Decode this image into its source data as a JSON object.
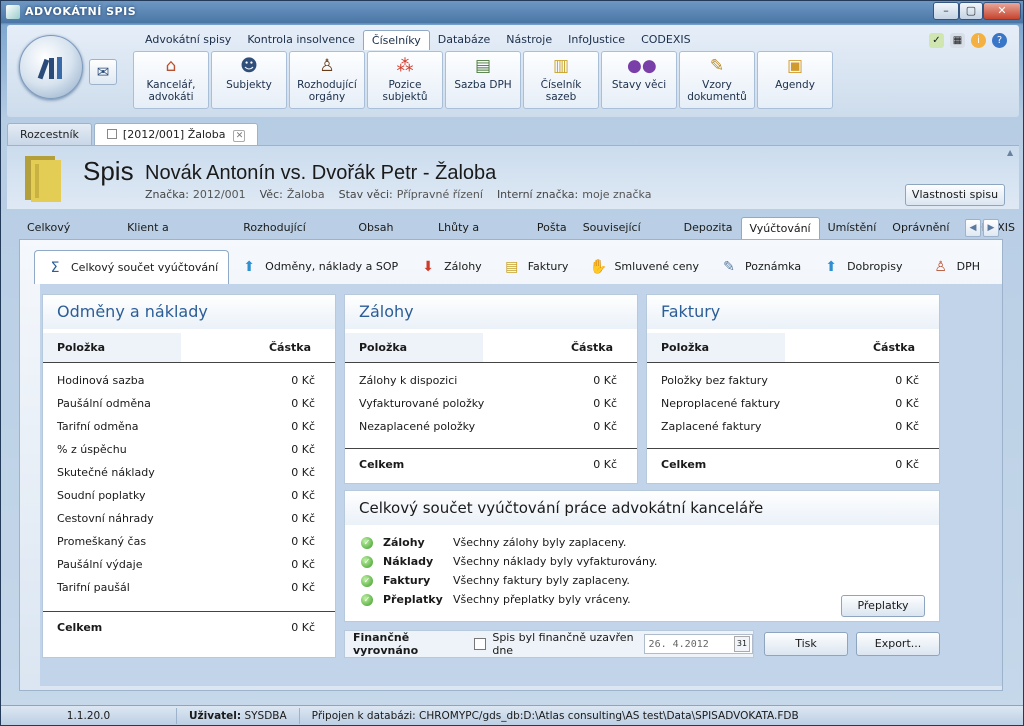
{
  "window": {
    "title": "ADVOKÁTNÍ SPIS"
  },
  "menu": {
    "tabs": [
      "Advokátní spisy",
      "Kontrola insolvence",
      "Číselníky",
      "Databáze",
      "Nástroje",
      "InfoJustice",
      "CODEXIS"
    ],
    "active": "Číselníky"
  },
  "toolbar": [
    {
      "label": "Kancelář, advokáti",
      "icon": "house-icon"
    },
    {
      "label": "Subjekty",
      "icon": "people-icon"
    },
    {
      "label": "Rozhodující orgány",
      "icon": "judge-icon"
    },
    {
      "label": "Pozice subjektů",
      "icon": "network-icon"
    },
    {
      "label": "Sazba DPH",
      "icon": "money-icon"
    },
    {
      "label": "Číselník sazeb",
      "icon": "calculator-icon"
    },
    {
      "label": "Stavy věci",
      "icon": "balls-icon"
    },
    {
      "label": "Vzory dokumentů",
      "icon": "document-pen-icon"
    },
    {
      "label": "Agendy",
      "icon": "clipboard-icon"
    }
  ],
  "doc_tabs": [
    {
      "label": "Rozcestník"
    },
    {
      "label": "[2012/001] Žaloba"
    }
  ],
  "spis": {
    "label": "Spis",
    "title": "Novák Antonín vs. Dvořák Petr - Žaloba",
    "znacka_k": "Značka:",
    "znacka_v": "2012/001",
    "vec_k": "Věc:",
    "vec_v": "Žaloba",
    "stav_k": "Stav věci:",
    "stav_v": "Přípravné řízení",
    "interni_k": "Interní značka:",
    "interni_v": "moje značka",
    "properties_button": "Vlastnosti spisu"
  },
  "section_tabs": [
    "Celkový přehled",
    "Klient a protistrana",
    "Rozhodující orgány",
    "Obsah spisu",
    "Lhůty a termíny",
    "Pošta",
    "Související spisy",
    "Depozita",
    "Vyúčtování",
    "Umístění",
    "Oprávnění",
    "CODEXIS"
  ],
  "section_active": "Vyúčtování",
  "sub_tabs": [
    {
      "label": "Celkový součet vyúčtování",
      "icon": "sigma-icon"
    },
    {
      "label": "Odměny, náklady a SOP",
      "icon": "arrow-up-icon"
    },
    {
      "label": "Zálohy",
      "icon": "arrow-down-icon"
    },
    {
      "label": "Faktury",
      "icon": "invoice-icon"
    },
    {
      "label": "Smluvené ceny",
      "icon": "handshake-icon"
    },
    {
      "label": "Poznámka",
      "icon": "note-icon"
    },
    {
      "label": "Dobropisy",
      "icon": "refund-icon"
    },
    {
      "label": "DPH",
      "icon": "person-icon"
    }
  ],
  "odmeny": {
    "title": "Odměny a náklady",
    "col_item": "Položka",
    "col_amount": "Částka",
    "rows": [
      {
        "item": "Hodinová sazba",
        "amount": "0 Kč"
      },
      {
        "item": "Paušální odměna",
        "amount": "0 Kč"
      },
      {
        "item": "Tarifní odměna",
        "amount": "0 Kč"
      },
      {
        "item": "% z úspěchu",
        "amount": "0 Kč"
      },
      {
        "item": "Skutečné náklady",
        "amount": "0 Kč"
      },
      {
        "item": "Soudní poplatky",
        "amount": "0 Kč"
      },
      {
        "item": "Cestovní náhrady",
        "amount": "0 Kč"
      },
      {
        "item": "Promeškaný čas",
        "amount": "0 Kč"
      },
      {
        "item": "Paušální výdaje",
        "amount": "0 Kč"
      },
      {
        "item": "Tarifní paušál",
        "amount": "0 Kč"
      }
    ],
    "total_label": "Celkem",
    "total_amount": "0 Kč"
  },
  "zalohy": {
    "title": "Zálohy",
    "col_item": "Položka",
    "col_amount": "Částka",
    "rows": [
      {
        "item": "Zálohy k dispozici",
        "amount": "0 Kč"
      },
      {
        "item": "Vyfakturované položky",
        "amount": "0 Kč"
      },
      {
        "item": "Nezaplacené položky",
        "amount": "0 Kč"
      }
    ],
    "total_label": "Celkem",
    "total_amount": "0 Kč"
  },
  "faktury": {
    "title": "Faktury",
    "col_item": "Položka",
    "col_amount": "Částka",
    "rows": [
      {
        "item": "Položky bez faktury",
        "amount": "0 Kč"
      },
      {
        "item": "Neproplacené faktury",
        "amount": "0 Kč"
      },
      {
        "item": "Zaplacené faktury",
        "amount": "0 Kč"
      }
    ],
    "total_label": "Celkem",
    "total_amount": "0 Kč"
  },
  "summary": {
    "title": "Celkový součet vyúčtování práce advokátní kanceláře",
    "rows": [
      {
        "label": "Zálohy",
        "text": "Všechny zálohy byly zaplaceny."
      },
      {
        "label": "Náklady",
        "text": "Všechny náklady byly vyfakturovány."
      },
      {
        "label": "Faktury",
        "text": "Všechny faktury byly zaplaceny."
      },
      {
        "label": "Přeplatky",
        "text": "Všechny přeplatky byly vráceny."
      }
    ],
    "overpay_button": "Přeplatky"
  },
  "financial": {
    "label": "Finančně vyrovnáno",
    "checkbox_label": "Spis byl finančně uzavřen dne",
    "date": "26. 4.2012",
    "print_button": "Tisk",
    "export_button": "Export..."
  },
  "status": {
    "version": "1.1.20.0",
    "user_label": "Uživatel:",
    "user": "SYSDBA",
    "db_text": "Připojen k databázi: CHROMYPC/gds_db:D:\\Atlas consulting\\AS test\\Data\\SPISADVOKATA.FDB"
  }
}
